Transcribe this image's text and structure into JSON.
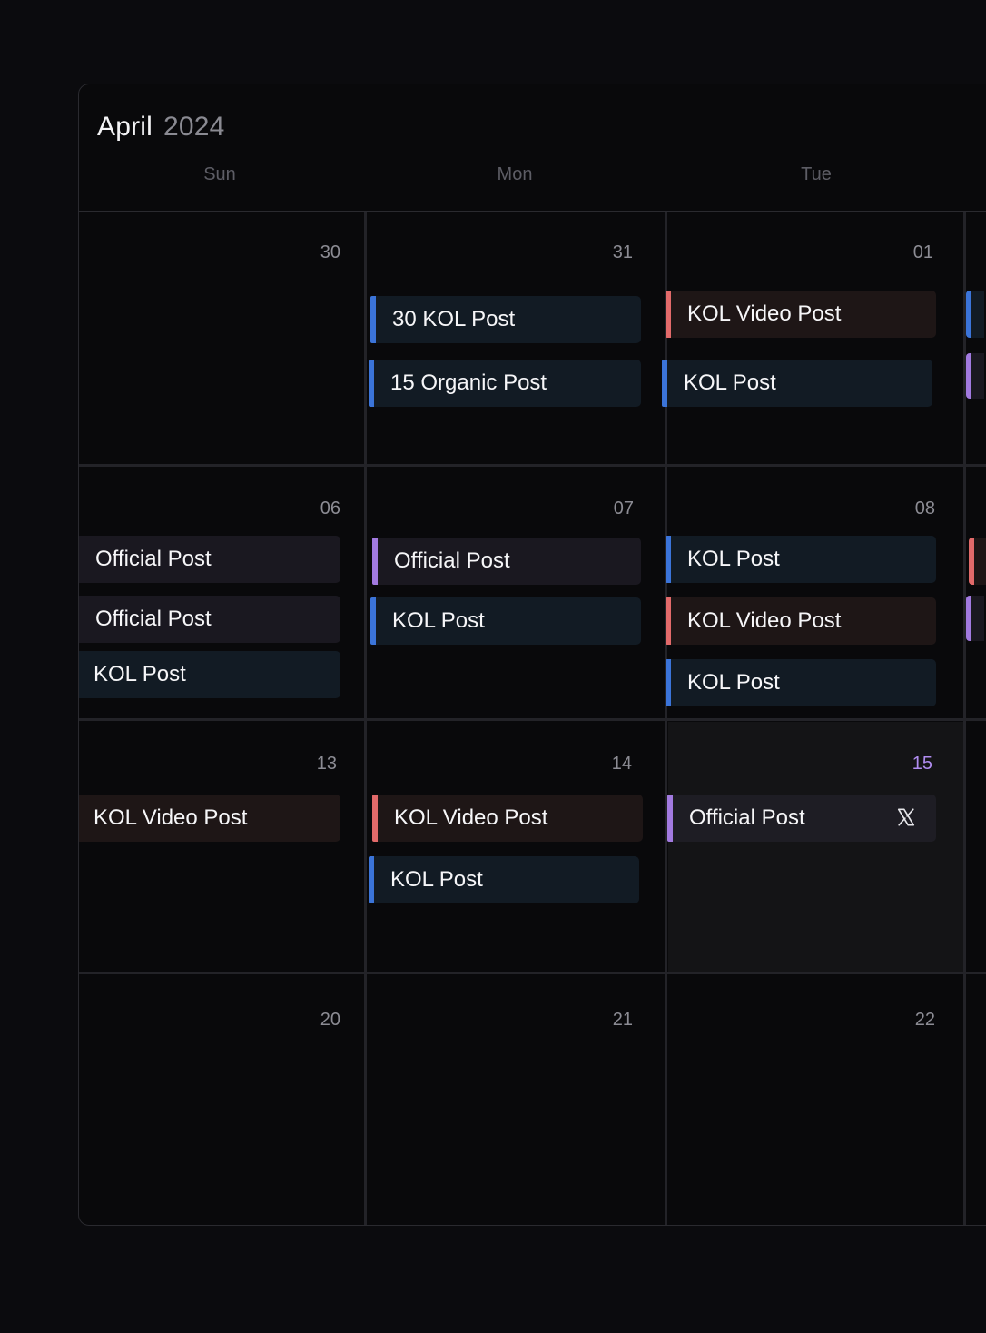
{
  "header": {
    "month": "April",
    "year": "2024"
  },
  "weekdays": [
    "Sun",
    "Mon",
    "Tue"
  ],
  "weeks": [
    {
      "days": [
        {
          "num": "30",
          "events": []
        },
        {
          "num": "31",
          "events": [
            {
              "label": "30 KOL Post",
              "type": "kol"
            },
            {
              "label": "15 Organic Post",
              "type": "kol"
            }
          ]
        },
        {
          "num": "01",
          "events": [
            {
              "label": "KOL Video Post",
              "type": "video"
            },
            {
              "label": "KOL Post",
              "type": "kol"
            }
          ]
        }
      ]
    },
    {
      "days": [
        {
          "num": "06",
          "events": [
            {
              "label": "Official Post",
              "type": "official"
            },
            {
              "label": "Official Post",
              "type": "official"
            },
            {
              "label": "KOL Post",
              "type": "kol"
            }
          ]
        },
        {
          "num": "07",
          "events": [
            {
              "label": "Official Post",
              "type": "official"
            },
            {
              "label": "KOL Post",
              "type": "kol"
            }
          ]
        },
        {
          "num": "08",
          "events": [
            {
              "label": "KOL Post",
              "type": "kol"
            },
            {
              "label": "KOL Video Post",
              "type": "video"
            },
            {
              "label": "KOL Post",
              "type": "kol"
            }
          ]
        }
      ]
    },
    {
      "days": [
        {
          "num": "13",
          "events": [
            {
              "label": "KOL Video Post",
              "type": "video"
            }
          ]
        },
        {
          "num": "14",
          "events": [
            {
              "label": "KOL Video Post",
              "type": "video"
            },
            {
              "label": "KOL Post",
              "type": "kol"
            }
          ]
        },
        {
          "num": "15",
          "today": true,
          "events": [
            {
              "label": "Official Post",
              "type": "official",
              "icon": "x-logo-icon"
            }
          ]
        }
      ]
    },
    {
      "days": [
        {
          "num": "20",
          "events": []
        },
        {
          "num": "21",
          "events": []
        },
        {
          "num": "22",
          "events": []
        }
      ]
    }
  ],
  "colors": {
    "kol": "#3b74d9",
    "video": "#e26a6a",
    "official": "#a27ae0",
    "today": "#b08cf0"
  }
}
